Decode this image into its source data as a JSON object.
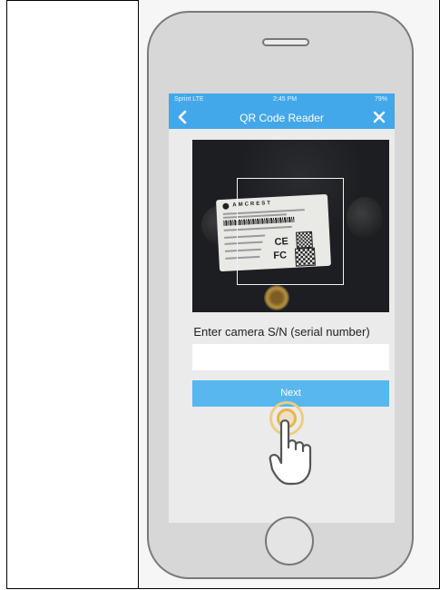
{
  "status_bar": {
    "carrier": "Sprint LTE",
    "time": "2:45 PM",
    "battery": "79%"
  },
  "nav": {
    "title": "QR Code Reader",
    "back_icon": "chevron-left-icon",
    "close_icon": "close-icon"
  },
  "camera_label": {
    "brand": "AMCREST",
    "ce": "CE",
    "fc": "FC"
  },
  "form": {
    "sn_label": "Enter camera S/N (serial number)",
    "sn_value": "",
    "next_label": "Next"
  },
  "colors": {
    "accent": "#43a8ea",
    "button": "#58b7ef",
    "tap_highlight": "#e9b64a"
  }
}
